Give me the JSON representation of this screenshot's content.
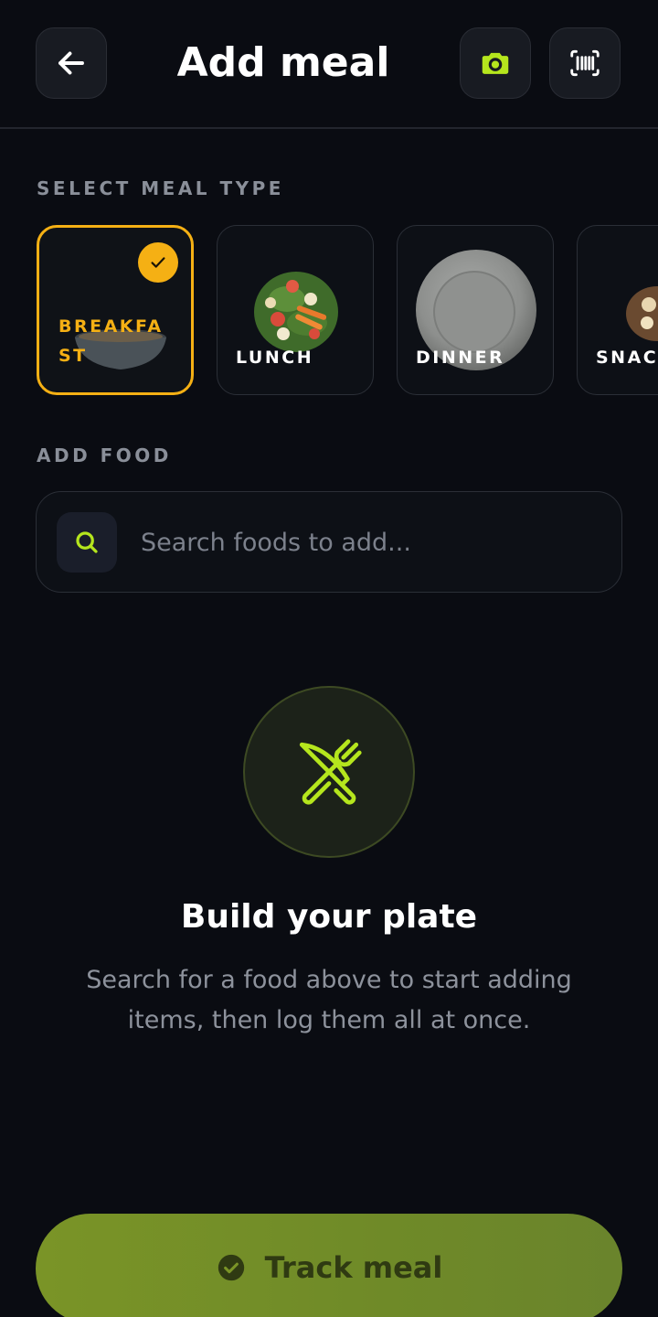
{
  "header": {
    "title": "Add meal",
    "back_icon": "arrow-left-icon",
    "camera_icon": "camera-icon",
    "barcode_icon": "barcode-icon"
  },
  "meal_type": {
    "section_label": "SELECT MEAL TYPE",
    "selected": "BREAKFAST",
    "options": [
      {
        "label": "BREAKFAST",
        "image": "bowl"
      },
      {
        "label": "LUNCH",
        "image": "salad-plate"
      },
      {
        "label": "DINNER",
        "image": "empty-plate"
      },
      {
        "label": "SNACK",
        "image": "snack-plate"
      }
    ]
  },
  "add_food": {
    "section_label": "ADD FOOD",
    "search_placeholder": "Search foods to add..."
  },
  "empty_state": {
    "icon": "utensils-icon",
    "title": "Build your plate",
    "description": "Search for a food above to start adding items, then log them all at once."
  },
  "footer": {
    "track_label": "Track meal",
    "track_icon": "check-circle-icon"
  },
  "colors": {
    "accent_yellow": "#f5b014",
    "accent_green": "#b5e61d",
    "background": "#0a0c12",
    "button_green": "#7a9427"
  }
}
